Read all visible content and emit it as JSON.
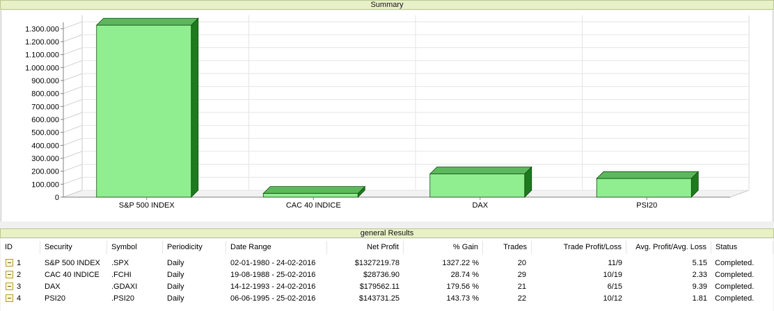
{
  "summary": {
    "title": "Summary"
  },
  "results": {
    "title": "general Results",
    "columns": [
      "ID",
      "Security",
      "Symbol",
      "Periodicity",
      "Date Range",
      "Net Profit",
      "% Gain",
      "Trades",
      "Trade Profit/Loss",
      "Avg. Profit/Avg. Loss",
      "Status"
    ],
    "rows": [
      {
        "id": "1",
        "security": "S&P 500 INDEX",
        "symbol": ".SPX",
        "periodicity": "Daily",
        "date_range": "02-01-1980 - 24-02-2016",
        "net_profit": "$1327219.78",
        "gain": "1327.22 %",
        "trades": "20",
        "trade_pl": "11/9",
        "avg_pl": "5.15",
        "status": "Completed."
      },
      {
        "id": "2",
        "security": "CAC 40 INDICE",
        "symbol": ".FCHI",
        "periodicity": "Daily",
        "date_range": "19-08-1988 - 25-02-2016",
        "net_profit": "$28736.90",
        "gain": "28.74 %",
        "trades": "29",
        "trade_pl": "10/19",
        "avg_pl": "2.33",
        "status": "Completed."
      },
      {
        "id": "3",
        "security": "DAX",
        "symbol": ".GDAXI",
        "periodicity": "Daily",
        "date_range": "14-12-1993 - 24-02-2016",
        "net_profit": "$179562.11",
        "gain": "179.56 %",
        "trades": "21",
        "trade_pl": "6/15",
        "avg_pl": "9.39",
        "status": "Completed."
      },
      {
        "id": "4",
        "security": "PSI20",
        "symbol": ".PSI20",
        "periodicity": "Daily",
        "date_range": "06-06-1995 - 25-02-2016",
        "net_profit": "$143731.25",
        "gain": "143.73 %",
        "trades": "22",
        "trade_pl": "10/12",
        "avg_pl": "1.81",
        "status": "Completed."
      }
    ]
  },
  "chart_data": {
    "type": "bar",
    "categories": [
      "S&P 500 INDEX",
      "CAC 40 INDICE",
      "DAX",
      "PSI20"
    ],
    "values": [
      1327219.78,
      28736.9,
      179562.11,
      143731.25
    ],
    "ylim": [
      0,
      1350000
    ],
    "yticks": [
      0,
      100000,
      200000,
      300000,
      400000,
      500000,
      600000,
      700000,
      800000,
      900000,
      1000000,
      1100000,
      1200000,
      1300000
    ],
    "ytick_labels": [
      "0",
      "100.000",
      "200.000",
      "300.000",
      "400.000",
      "500.000",
      "600.000",
      "700.000",
      "800.000",
      "900.000",
      "1.000.000",
      "1.100.000",
      "1.200.000",
      "1.300.000"
    ],
    "grid": true,
    "style": "3d",
    "colors": {
      "face": "#90ee90",
      "top": "#5cb85c",
      "side": "#1e7a1e",
      "outline": "#0d4a0d"
    }
  }
}
